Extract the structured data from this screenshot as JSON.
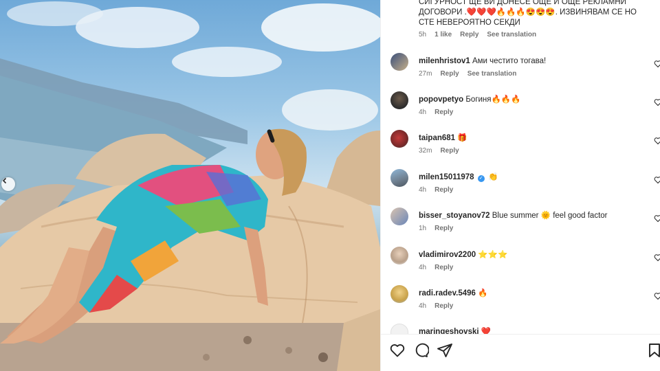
{
  "post_caption": {
    "text": "СИГУРНОСТ ЩЕ ВИ ДОНЕСЕ ОЩЕ И ОЩЕ РЕКЛАМНИ ДОГОВОРИ .❤️❤️❤️🔥🔥🔥😍😍😍. ИЗВИНЯВАМ СЕ НО СТЕ НЕВЕРОЯТНО СЕКДИ",
    "time": "5h",
    "likes": "1 like",
    "reply": "Reply",
    "translate": "See translation"
  },
  "comments": [
    {
      "user": "milenhristov1",
      "text": "Ами честито тогава!",
      "time": "27m",
      "reply": "Reply",
      "translate": "See translation",
      "verified": false
    },
    {
      "user": "popovpetyo",
      "text": "Богиня🔥🔥🔥",
      "time": "4h",
      "reply": "Reply",
      "verified": false
    },
    {
      "user": "taipan681",
      "text": "🎁",
      "time": "32m",
      "reply": "Reply",
      "verified": false
    },
    {
      "user": "milen15011978",
      "text": "👏",
      "time": "4h",
      "reply": "Reply",
      "verified": true
    },
    {
      "user": "bisser_stoyanov72",
      "text": "Blue summer 🌞 feel good factor",
      "time": "1h",
      "reply": "Reply",
      "verified": false
    },
    {
      "user": "vladimirov2200",
      "text": "⭐⭐⭐",
      "time": "4h",
      "reply": "Reply",
      "verified": false
    },
    {
      "user": "radi.radev.5496",
      "text": "🔥",
      "time": "4h",
      "reply": "Reply",
      "verified": false
    },
    {
      "user": "maringeshovski",
      "text": "❤️",
      "time": "",
      "reply": "",
      "verified": false
    }
  ],
  "actions": {
    "like_icon": "heart-icon",
    "comment_icon": "comment-icon",
    "share_icon": "share-icon",
    "save_icon": "bookmark-icon"
  },
  "colors": {
    "text": "#262626",
    "meta": "#737373",
    "verified": "#3897f0",
    "divider": "#efefef"
  }
}
